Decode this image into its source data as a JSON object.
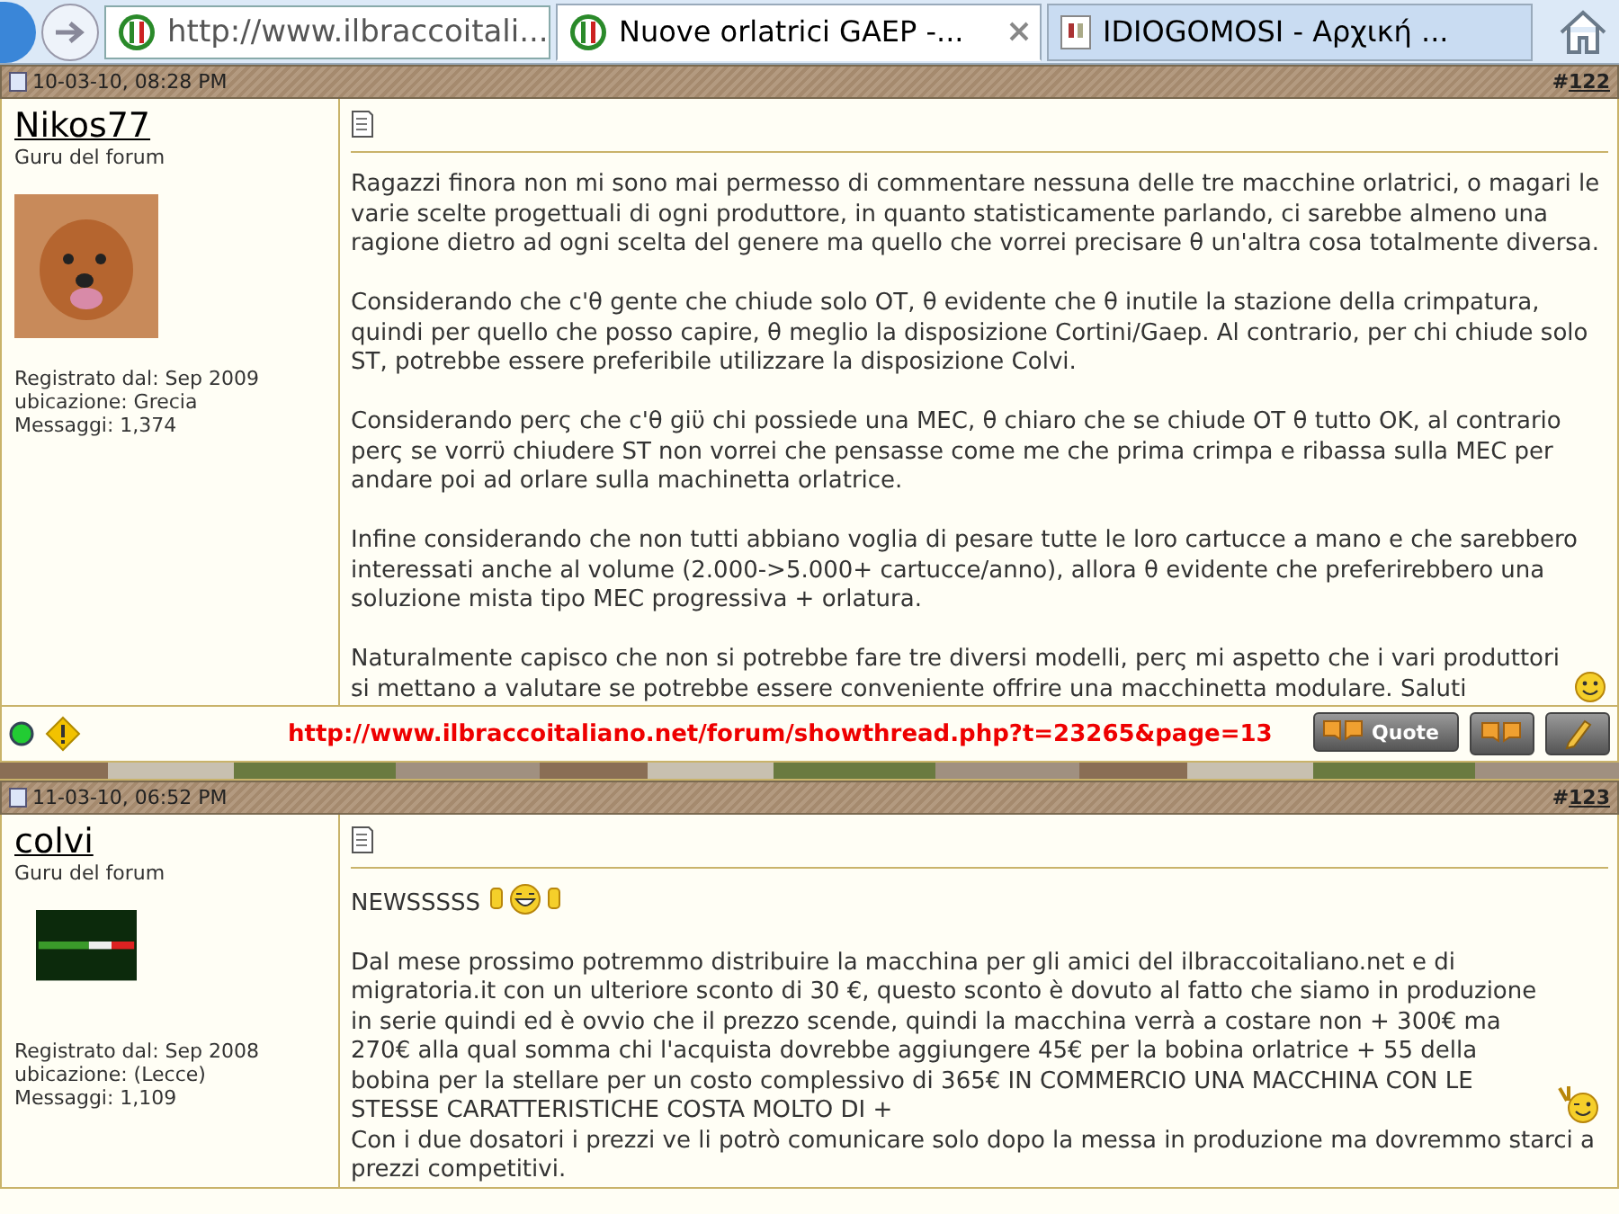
{
  "browser": {
    "address": "http://www.ilbraccoitali...",
    "tabs": [
      {
        "title": "Nuove orlatrici GAEP -...",
        "selected": true
      },
      {
        "title": "IDIOGOMOSI - Αρχική ...",
        "selected": false
      }
    ]
  },
  "posts": [
    {
      "date": "10-03-10, 08:28 PM",
      "number_sign": "#",
      "number": "122",
      "username": "Nikos77",
      "user_title": "Guru del forum",
      "registered": "Registrato dal: Sep 2009",
      "location": "ubicazione: Grecia",
      "post_count": "Messaggi: 1,374",
      "paragraphs": [
        {
          "lines": [
            {
              "kind": "plain",
              "text": "Ragazzi finora non mi sono mai permesso di commentare nessuna delle tre macchine orlatrici, o magari le varie scelte progettuali di ogni produttore, in quanto statisticamente parlando, ci sarebbe almeno una ragione dietro ad ogni scelta del genere ma quello che vorrei precisare θ un'altra cosa totalmente diversa."
            }
          ]
        },
        {
          "lines": [
            {
              "kind": "plain",
              "text": "Considerando che c'θ gente che chiude solo OT, θ evidente che θ inutile la stazione della crimpatura, quindi per quello che posso capire, θ meglio la disposizione Cortini/Gaep. Al contrario, per chi chiude solo ST, potrebbe essere preferibile utilizzare la disposizione Colvi."
            }
          ]
        },
        {
          "lines": [
            {
              "kind": "plain",
              "text": "Considerando perς che c'θ giϋ chi possiede una MEC, θ chiaro che se chiude OT θ tutto OK, al contrario perς se vorrϋ chiudere ST non vorrei che pensasse come me che prima crimpa e ribassa sulla MEC per andare poi ad orlare sulla machinetta orlatrice."
            }
          ]
        },
        {
          "lines": [
            {
              "kind": "plain",
              "text": "Infine considerando che non tutti abbiano voglia di pesare tutte le loro cartucce a mano e che sarebbero interessati anche al volume (2.000->5.000+ cartucce/anno), allora θ evidente che preferirebbero una soluzione mista tipo MEC progressiva + orlatura."
            }
          ]
        },
        {
          "lines": [
            {
              "kind": "smile",
              "text": "Naturalmente capisco che non si potrebbe fare tre diversi modelli, perς mi aspetto che i vari produttori si mettano a valutare se potrebbe essere conveniente offrire una macchinetta modulare. Saluti"
            }
          ]
        }
      ],
      "footer": {
        "online": true,
        "signature_link": "http://www.ilbraccoitaliano.net/forum/showthread.php?t=23265&page=13",
        "quote_label": "Quote"
      }
    },
    {
      "date": "11-03-10, 06:52 PM",
      "number_sign": "#",
      "number": "123",
      "username": "colvi",
      "user_title": "Guru del forum",
      "registered": "Registrato dal: Sep 2008",
      "location": "ubicazione: (Lecce)",
      "post_count": "Messaggi: 1,109",
      "paragraphs": [
        {
          "lines": [
            {
              "kind": "thumbs",
              "text": "NEWSSSSS"
            }
          ]
        },
        {
          "lines": [
            {
              "kind": "wink",
              "text": "Dal mese prossimo potremmo distribuire la macchina per gli amici del ilbraccoitaliano.net e di migratoria.it con un ulteriore sconto di 30 €, questo sconto è dovuto al fatto che siamo in produzione in serie quindi ed è ovvio che il prezzo scende, quindi la macchina verrà a costare non + 300€ ma 270€ alla qual somma chi l'acquista dovrebbe aggiungere 45€ per la bobina orlatrice + 55 della bobina per la stellare per un costo complessivo di 365€ IN COMMERCIO UNA MACCHINA CON LE STESSE CARATTERISTICHE COSTA MOLTO DI +"
            },
            {
              "kind": "plain",
              "text": "Con i due dosatori i prezzi ve li potrò comunicare solo dopo la messa in produzione ma dovremmo starci a prezzi competitivi."
            }
          ]
        }
      ]
    }
  ]
}
